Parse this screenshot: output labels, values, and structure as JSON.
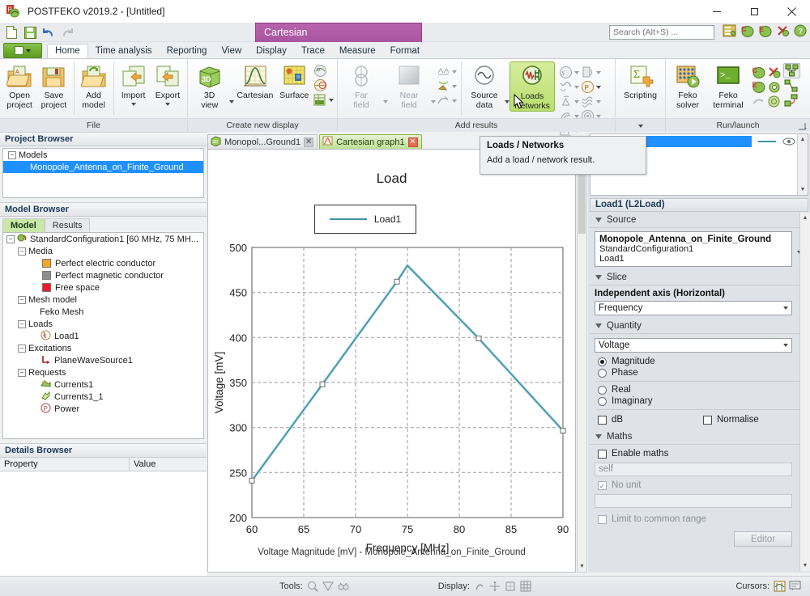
{
  "window": {
    "title": "POSTFEKO v2019.2 - [Untitled]",
    "app_icon": "postfeko-icon",
    "minimize": "–",
    "maximize": "□",
    "close": "✕"
  },
  "quick_access": {
    "items": [
      {
        "name": "new-icon",
        "glyph": "🗋"
      },
      {
        "name": "save-icon",
        "glyph": "💾"
      },
      {
        "name": "undo-icon",
        "glyph": "↶"
      },
      {
        "name": "redo-icon",
        "glyph": "↷"
      }
    ],
    "context_tab_title": "Cartesian",
    "right_icons": [
      {
        "name": "notes-icon"
      },
      {
        "name": "cadfeko-icon"
      },
      {
        "name": "editfeko-icon"
      },
      {
        "name": "optfeko-icon"
      },
      {
        "name": "help-icon"
      }
    ]
  },
  "search": {
    "placeholder": "Search (Alt+S) ...",
    "value": ""
  },
  "ribbon": {
    "file_menu_label": "File menu",
    "tabs": [
      {
        "label": "Home",
        "active": true
      },
      {
        "label": "Time analysis",
        "active": false
      },
      {
        "label": "Reporting",
        "active": false
      },
      {
        "label": "View",
        "active": false
      },
      {
        "label": "Display",
        "active": false
      },
      {
        "label": "Trace",
        "active": false
      },
      {
        "label": "Measure",
        "active": false
      },
      {
        "label": "Format",
        "active": false
      }
    ],
    "groups": [
      {
        "name": "file",
        "label": "File",
        "buttons": [
          {
            "label": "Open\nproject",
            "line1": "Open",
            "line2": "project",
            "icon": "open-project-icon",
            "disabled": false,
            "selected": false
          },
          {
            "label": "Save project",
            "line1": "Save",
            "line2": "project",
            "icon": "save-project-icon",
            "disabled": false,
            "selected": false
          },
          {
            "label": "Add model",
            "line1": "Add",
            "line2": "model",
            "icon": "add-model-icon",
            "disabled": false,
            "selected": false
          },
          {
            "label": "Import",
            "line1": "Import",
            "line2": "",
            "icon": "import-icon",
            "disabled": false,
            "selected": false,
            "dropdown": true
          },
          {
            "label": "Export",
            "line1": "Export",
            "line2": "",
            "icon": "export-icon",
            "disabled": false,
            "selected": false,
            "dropdown": true
          }
        ]
      },
      {
        "name": "create-new-display",
        "label": "Create new display",
        "buttons": [
          {
            "label": "3D view",
            "line1": "3D",
            "line2": "view",
            "icon": "3d-view-icon",
            "disabled": false,
            "selected": false,
            "dropdown": true
          },
          {
            "label": "Cartesian",
            "line1": "Cartesian",
            "line2": "",
            "icon": "cartesian-graph-icon",
            "disabled": false,
            "selected": false
          },
          {
            "label": "Surface",
            "line1": "Surface",
            "line2": "",
            "icon": "surface-graph-icon",
            "disabled": false,
            "selected": false
          }
        ],
        "small_buttons": [
          {
            "name": "polar-graph-icon"
          },
          {
            "name": "smith-chart-icon"
          },
          {
            "name": "table-icon",
            "dropdown": true
          }
        ]
      },
      {
        "name": "add-results",
        "label": "Add results",
        "buttons": [
          {
            "label": "Far field",
            "line1": "Far",
            "line2": "field",
            "icon": "far-field-icon",
            "disabled": true,
            "selected": false,
            "dropdown": true
          },
          {
            "label": "Near field",
            "line1": "Near",
            "line2": "field",
            "icon": "near-field-icon",
            "disabled": true,
            "selected": false,
            "dropdown": true
          },
          {
            "label": "Source data",
            "line1": "Source",
            "line2": "data",
            "icon": "source-data-icon",
            "disabled": false,
            "selected": false,
            "dropdown": true
          },
          {
            "label": "Loads Networks",
            "line1": "Loads",
            "line2": "Networks",
            "icon": "loads-networks-icon",
            "disabled": false,
            "selected": true
          }
        ],
        "small_buttons": [
          {
            "name": "s-parameters-icon"
          },
          {
            "name": "power-icon"
          },
          {
            "name": "antenna-icon"
          },
          {
            "name": "currents-icon"
          },
          {
            "name": "sar-icon"
          },
          {
            "name": "receiving-antenna-icon"
          },
          {
            "name": "cable-icon"
          },
          {
            "name": "cable-mesh-icon"
          },
          {
            "name": "report-icon"
          }
        ]
      },
      {
        "name": "scripting",
        "label": "",
        "buttons": [
          {
            "label": "Scripting",
            "line1": "Scripting",
            "line2": "",
            "icon": "scripting-icon",
            "disabled": false,
            "selected": false
          }
        ]
      },
      {
        "name": "run-launch",
        "label": "Run/launch",
        "buttons": [
          {
            "label": "Feko solver",
            "line1": "Feko",
            "line2": "solver",
            "icon": "feko-solver-icon",
            "disabled": false,
            "selected": false
          },
          {
            "label": "Feko terminal",
            "line1": "Feko",
            "line2": "terminal",
            "icon": "feko-terminal-icon",
            "disabled": false,
            "selected": false
          }
        ],
        "small_buttons": [
          {
            "name": "cadfeko-launch-icon"
          },
          {
            "name": "optfeko-launch-icon"
          },
          {
            "name": "editfeko-launch-icon"
          },
          {
            "name": "rerun-icon"
          },
          {
            "name": "pointwise-icon"
          },
          {
            "name": "component-launcher-icon"
          },
          {
            "name": "remote-launcher-icon"
          },
          {
            "name": "cluster-icon"
          },
          {
            "name": "node-icon"
          }
        ]
      }
    ]
  },
  "project_browser": {
    "title": "Project Browser",
    "nodes": [
      {
        "label": "Models",
        "depth": 0,
        "expander": "−",
        "selected": false
      },
      {
        "label": "Monopole_Antenna_on_Finite_Ground",
        "depth": 1,
        "expander": "",
        "selected": true
      }
    ]
  },
  "model_browser": {
    "title": "Model Browser",
    "tabs": [
      {
        "label": "Model",
        "active": true
      },
      {
        "label": "Results",
        "active": false
      }
    ],
    "nodes": [
      {
        "label": "StandardConfiguration1 [60 MHz, 75 MH...",
        "depth": 0,
        "expander": "−",
        "icon": "configuration-icon"
      },
      {
        "label": "Media",
        "depth": 1,
        "expander": "−",
        "icon": ""
      },
      {
        "label": "Perfect electric conductor",
        "depth": 2,
        "expander": "",
        "icon": "swatch",
        "color": "#f5a623"
      },
      {
        "label": "Perfect magnetic conductor",
        "depth": 2,
        "expander": "",
        "icon": "swatch",
        "color": "#8e8e8e"
      },
      {
        "label": "Free space",
        "depth": 2,
        "expander": "",
        "icon": "swatch",
        "color": "#ec1c24"
      },
      {
        "label": "Mesh model",
        "depth": 1,
        "expander": "−",
        "icon": ""
      },
      {
        "label": "Feko Mesh",
        "depth": 2,
        "expander": "",
        "icon": ""
      },
      {
        "label": "Loads",
        "depth": 1,
        "expander": "−",
        "icon": ""
      },
      {
        "label": "Load1",
        "depth": 2,
        "expander": "",
        "icon": "load-icon"
      },
      {
        "label": "Excitations",
        "depth": 1,
        "expander": "−",
        "icon": ""
      },
      {
        "label": "PlaneWaveSource1",
        "depth": 2,
        "expander": "",
        "icon": "plane-wave-icon"
      },
      {
        "label": "Requests",
        "depth": 1,
        "expander": "−",
        "icon": ""
      },
      {
        "label": "Currents1",
        "depth": 2,
        "expander": "",
        "icon": "currents-request-icon"
      },
      {
        "label": "Currents1_1",
        "depth": 2,
        "expander": "",
        "icon": "currents-request-icon"
      },
      {
        "label": "Power",
        "depth": 2,
        "expander": "",
        "icon": "power-request-icon"
      }
    ]
  },
  "details_browser": {
    "title": "Details Browser",
    "columns": [
      "Property",
      "Value"
    ],
    "rows": []
  },
  "document_tabs": [
    {
      "label": "Monopol...Ground1",
      "icon": "3d-model-icon",
      "active": false,
      "close": "✕"
    },
    {
      "label": "Cartesian graph1",
      "icon": "cartesian-graph-icon",
      "active": true,
      "close": "✕"
    }
  ],
  "tooltip": {
    "title": "Loads / Networks",
    "body": "Add a load / network result."
  },
  "chart_data": {
    "type": "line",
    "title": "Load",
    "xlabel": "Frequency [MHz]",
    "ylabel": "Voltage [mV]",
    "xlim": [
      60,
      90
    ],
    "ylim": [
      200,
      500
    ],
    "xticks": [
      60,
      65,
      70,
      75,
      80,
      85,
      90
    ],
    "yticks": [
      200,
      250,
      300,
      350,
      400,
      450,
      500
    ],
    "grid": true,
    "legend_position": "top-center",
    "caption": "Voltage Magnitude [mV] - Monopole_Antenna_on_Finite_Ground",
    "series": [
      {
        "name": "Load1",
        "color": "#3f93a8",
        "marker": "square",
        "x": [
          60,
          66.8,
          74,
          75,
          81.9,
          90
        ],
        "y": [
          228,
          335,
          449,
          467,
          386,
          288
        ]
      }
    ]
  },
  "right_panel": {
    "trace_list": {
      "rows": [
        {
          "name": "",
          "selected": true,
          "line_color": "#3f93a8",
          "visibility_icon": "eye-icon"
        }
      ]
    },
    "header": "Load1 (L2Load)",
    "sections": [
      {
        "name": "source",
        "label": "Source"
      },
      {
        "name": "slice",
        "label": "Slice"
      },
      {
        "name": "quantity",
        "label": "Quantity"
      },
      {
        "name": "maths",
        "label": "Maths"
      }
    ],
    "source": {
      "model": "Monopole_Antenna_on_Finite_Ground",
      "configuration": "StandardConfiguration1",
      "load": "Load1"
    },
    "independent_axis": {
      "label": "Independent axis (Horizontal)",
      "value": "Frequency",
      "options": [
        "Frequency"
      ]
    },
    "quantity": {
      "value": "Voltage",
      "options": [
        "Voltage"
      ],
      "component": "Magnitude",
      "radios": [
        {
          "label": "Magnitude",
          "checked": true
        },
        {
          "label": "Phase",
          "checked": false
        },
        {
          "label": "Real",
          "checked": false
        },
        {
          "label": "Imaginary",
          "checked": false
        }
      ],
      "checkboxes": [
        {
          "label": "dB",
          "checked": false
        },
        {
          "label": "Normalise",
          "checked": false
        }
      ]
    },
    "maths": {
      "enable_label": "Enable maths",
      "enable_checked": false,
      "expression_value": "self",
      "no_unit_label": "No unit",
      "no_unit_checked": true,
      "unit_value": "",
      "limit_label": "Limit to common range",
      "limit_checked": false,
      "editor_button": "Editor"
    }
  },
  "status_bar": {
    "tools_label": "Tools:",
    "tools_icons": [
      "zoom-tool-icon",
      "pan-tool-icon",
      "measure-tool-icon"
    ],
    "display_label": "Display:",
    "display_icons": [
      "rotate-icon",
      "move-icon",
      "snap-icon",
      "grid-icon"
    ],
    "cursors_label": "Cursors:",
    "cursors_icons": [
      "cursor-trace-icon",
      "cursor-label-icon"
    ]
  }
}
